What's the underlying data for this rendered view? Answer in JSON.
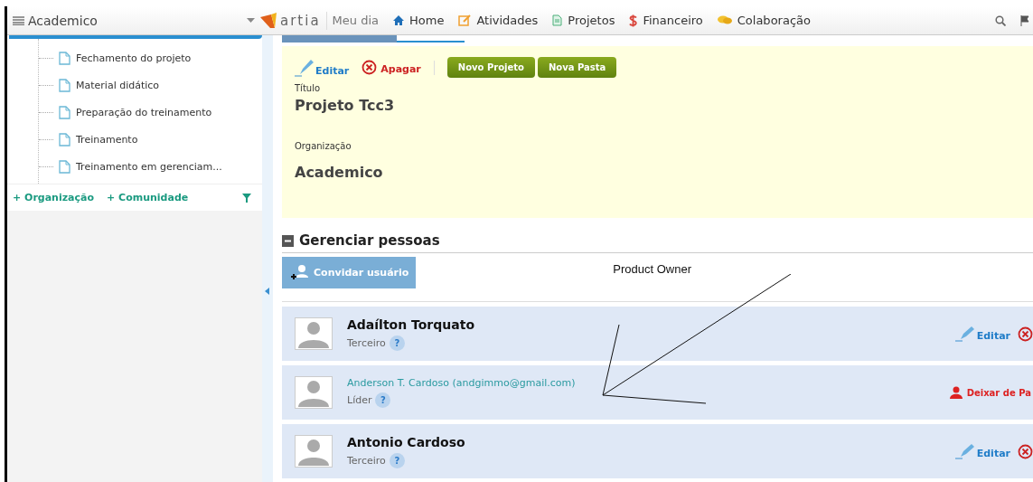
{
  "header": {
    "workspace": "Academico",
    "logo": "artia",
    "nav": [
      {
        "label": "Meu dia"
      },
      {
        "label": "Home"
      },
      {
        "label": "Atividades"
      },
      {
        "label": "Projetos"
      },
      {
        "label": "Financeiro"
      },
      {
        "label": "Colaboração"
      }
    ]
  },
  "sidebar": {
    "items": [
      {
        "label": "Fechamento do projeto"
      },
      {
        "label": "Material didático"
      },
      {
        "label": "Preparação do treinamento"
      },
      {
        "label": "Treinamento"
      },
      {
        "label": "Treinamento em gerenciam..."
      }
    ],
    "links": [
      "+ Organização",
      "+ Comunidade"
    ]
  },
  "project": {
    "actions": {
      "edit": "Editar",
      "delete": "Apagar"
    },
    "buttons": [
      "Novo Projeto",
      "Nova Pasta"
    ],
    "fields": [
      {
        "label": "Título",
        "value": "Projeto Tcc3"
      },
      {
        "label": "Organização",
        "value": "Academico"
      }
    ]
  },
  "people": {
    "title": "Gerenciar pessoas",
    "invite": "Convidar usuário",
    "annotation": "Product Owner",
    "members": [
      {
        "kind": "member",
        "name": "Adaílton Torquato",
        "role": "Terceiro",
        "help": "?",
        "action": "Editar"
      },
      {
        "kind": "self",
        "name": "Anderson T. Cardoso (andgimmo@gmail.com)",
        "role": "Líder",
        "help": "?",
        "action": "Deixar de Pa"
      },
      {
        "kind": "member",
        "name": "Antonio Cardoso",
        "role": "Terceiro",
        "help": "?",
        "action": "Editar"
      }
    ]
  }
}
